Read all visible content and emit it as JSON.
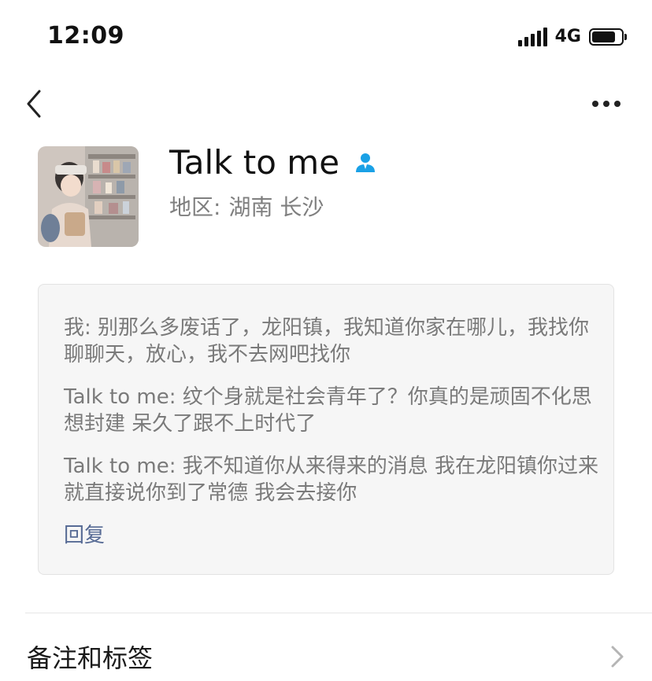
{
  "status_bar": {
    "time": "12:09",
    "network": "4G"
  },
  "nav": {
    "back_icon": "chevron-left-icon",
    "more_icon": "more-horizontal-icon"
  },
  "profile": {
    "name": "Talk to me",
    "gender_icon": "male-icon",
    "gender_color": "#1aa1e6",
    "region_label": "地区:",
    "region_value": "湖南 长沙"
  },
  "moments_card": {
    "comments": [
      {
        "text": "我: 别那么多废话了，龙阳镇，我知道你家在哪儿，我找你聊聊天，放心，我不去网吧找你"
      },
      {
        "text": "Talk to me: 纹个身就是社会青年了？你真的是顽固不化思想封建   呆久了跟不上时代了"
      },
      {
        "text": "Talk to me: 我不知道你从来得来的消息 我在龙阳镇你过来就直接说你到了常德   我会去接你"
      }
    ],
    "reply_label": "回复",
    "link_color": "#576b95"
  },
  "menu": {
    "remarks_label": "备注和标签"
  }
}
